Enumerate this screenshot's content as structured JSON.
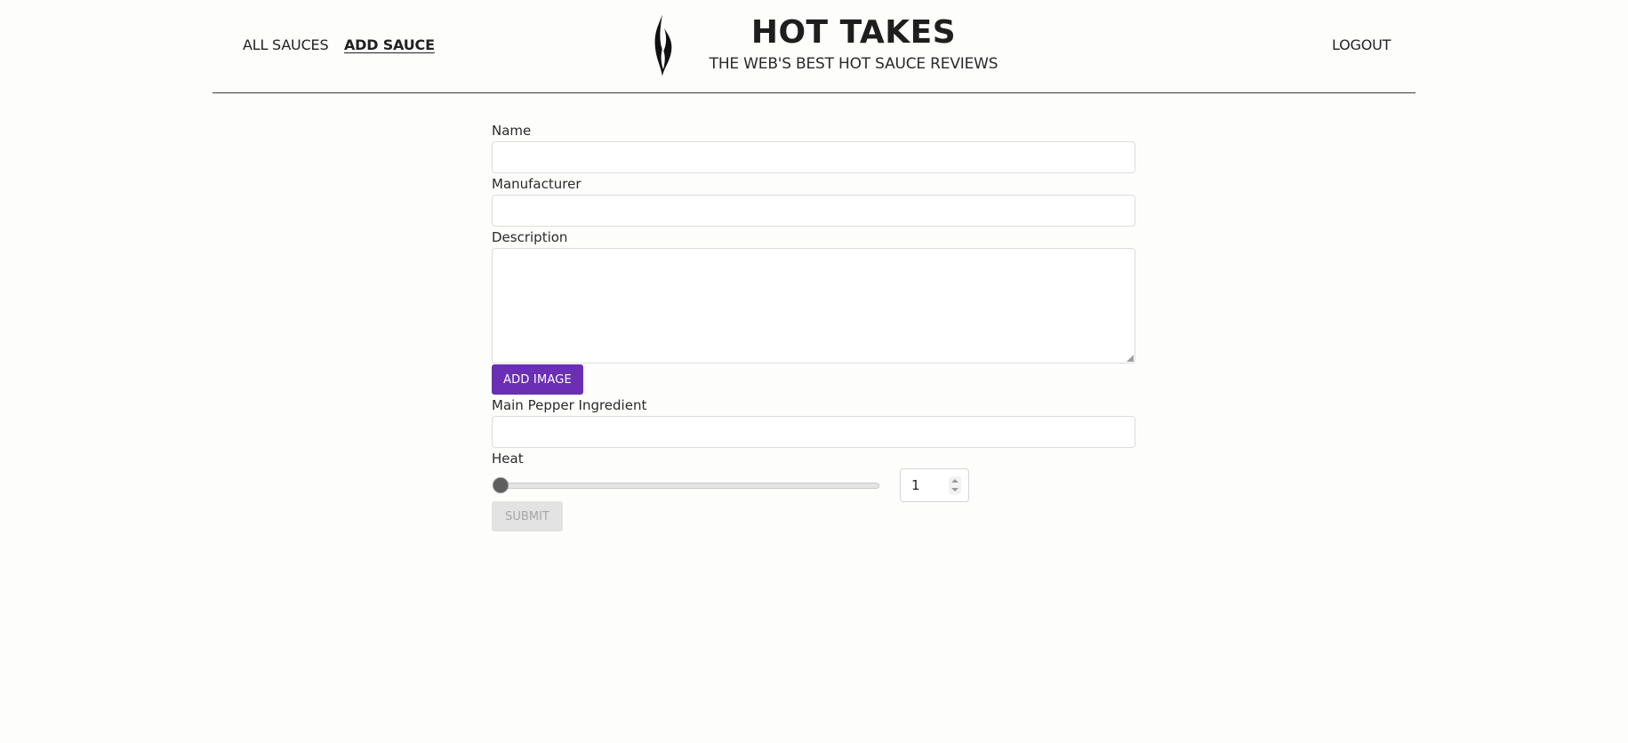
{
  "nav": {
    "all_sauces": "ALL SAUCES",
    "add_sauce": "ADD SAUCE",
    "logout": "LOGOUT"
  },
  "brand": {
    "title": "HOT TAKES",
    "subtitle": "THE WEB'S BEST HOT SAUCE REVIEWS",
    "logo_icon": "flame-icon"
  },
  "form": {
    "name": {
      "label": "Name",
      "value": ""
    },
    "manufacturer": {
      "label": "Manufacturer",
      "value": ""
    },
    "description": {
      "label": "Description",
      "value": ""
    },
    "add_image_label": "ADD IMAGE",
    "main_pepper": {
      "label": "Main Pepper Ingredient",
      "value": ""
    },
    "heat": {
      "label": "Heat",
      "value": "1",
      "min": 1,
      "max": 10
    },
    "submit_label": "SUBMIT"
  },
  "colors": {
    "accent": "#6a2fb4",
    "disabled_bg": "#e3e3e3",
    "disabled_text": "#a6a6a6"
  }
}
